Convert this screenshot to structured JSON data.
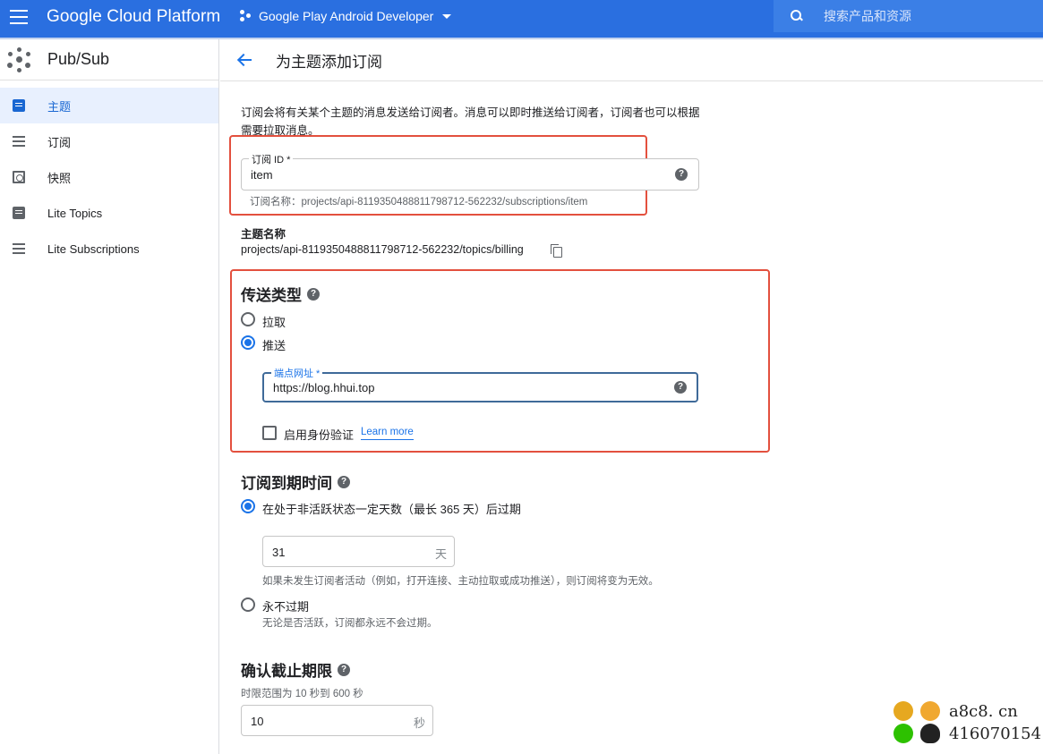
{
  "topbar": {
    "brand": "Google Cloud Platform",
    "project_name": "Google Play Android Developer",
    "search_placeholder": "搜索产品和资源"
  },
  "sidebar": {
    "title": "Pub/Sub",
    "items": [
      {
        "label": "主题",
        "icon": "topic-icon",
        "active": true
      },
      {
        "label": "订阅",
        "icon": "list-icon",
        "active": false
      },
      {
        "label": "快照",
        "icon": "snapshot-icon",
        "active": false
      },
      {
        "label": "Lite Topics",
        "icon": "topic-icon",
        "active": false
      },
      {
        "label": "Lite Subscriptions",
        "icon": "list-icon",
        "active": false
      }
    ]
  },
  "page": {
    "title": "为主题添加订阅",
    "intro": "订阅会将有关某个主题的消息发送给订阅者。消息可以即时推送给订阅者，订阅者也可以根据需要拉取消息。"
  },
  "subscription_id": {
    "label": "订阅 ID *",
    "value": "item",
    "hint": "订阅名称：projects/api-8119350488811798712-562232/subscriptions/item"
  },
  "topic_name": {
    "label": "主题名称",
    "value": "projects/api-8119350488811798712-562232/topics/billing"
  },
  "delivery_type": {
    "title": "传送类型",
    "options": [
      {
        "label": "拉取",
        "selected": false
      },
      {
        "label": "推送",
        "selected": true
      }
    ],
    "endpoint": {
      "label": "端点网址 *",
      "value": "https://blog.hhui.top"
    },
    "auth_checkbox": {
      "label": "启用身份验证",
      "checked": false
    },
    "learn_more": "Learn more"
  },
  "expiration": {
    "title": "订阅到期时间",
    "option_inactive": "在处于非活跃状态一定天数（最长 365 天）后过期",
    "days_value": "31",
    "days_suffix": "天",
    "days_hint": "如果未发生订阅者活动（例如，打开连接、主动拉取或成功推送），则订阅将变为无效。",
    "option_never": "永不过期",
    "never_hint": "无论是否活跃，订阅都永远不会过期。",
    "selected": "inactive"
  },
  "ack_deadline": {
    "title": "确认截止期限",
    "hint": "时限范围为 10 秒到 600 秒",
    "value": "10",
    "suffix": "秒"
  },
  "watermark": {
    "site": "a8c8. cn",
    "qq": "416070154"
  },
  "colors": {
    "topbar": "#2a6fe0",
    "accent": "#1a73e8",
    "highlight_box": "#e3503e"
  }
}
